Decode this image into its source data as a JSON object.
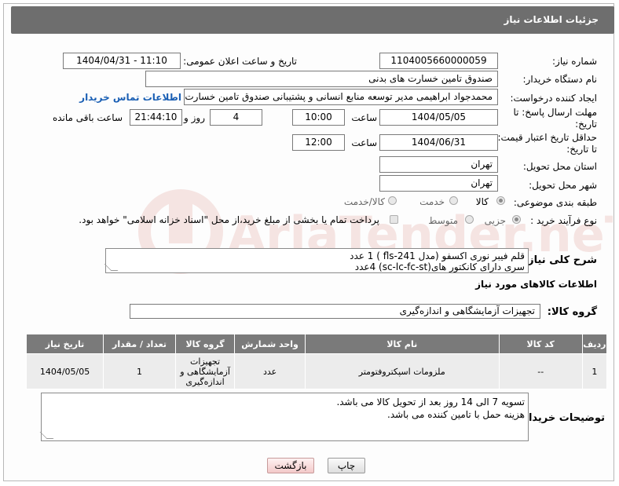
{
  "header": {
    "title": "جزئیات اطلاعات نیاز"
  },
  "fields": {
    "need_number_label": "شماره نیاز:",
    "need_number": "1104005660000059",
    "announce_label": "تاریخ و ساعت اعلان عمومی:",
    "announce_value": "1404/04/31 - 11:10",
    "buyer_org_label": "نام دستگاه خریدار:",
    "buyer_org": "صندوق تامین خسارت های بدنی",
    "creator_label": "ایجاد کننده درخواست:",
    "creator": "محمدجواد ابراهیمی مدیر توسعه منابع انسانی و پشتیبانی صندوق تامین خسارت های بدنی",
    "contact_link": "اطلاعات تماس خریدار",
    "deadline_label_1": "مهلت ارسال پاسخ: تا",
    "deadline_label_2": "تاریخ:",
    "deadline_date": "1404/05/05",
    "time_label": "ساعت",
    "deadline_time": "10:00",
    "days_value": "4",
    "days_label": "روز و",
    "remaining_time": "21:44:10",
    "remaining_label": "ساعت باقی مانده",
    "min_price_label_1": "حداقل تاریخ اعتبار قیمت:",
    "min_price_label_2": "تا تاریخ:",
    "price_date": "1404/06/31",
    "price_time_label": "ساعت",
    "price_time": "12:00",
    "province_label": "استان محل تحویل:",
    "province": "تهران",
    "city_label": "شهر محل تحویل:",
    "city": "تهران",
    "category_label": "طبقه بندی موضوعی:",
    "category_goods": "کالا",
    "category_service": "خدمت",
    "category_both": "کالا/خدمت",
    "process_label": "نوع فرآیند خرید :",
    "process_small": "جزیی",
    "process_medium": "متوسط",
    "process_note": "پرداخت تمام یا بخشی از مبلغ خرید،از محل \"اسناد خزانه اسلامی\" خواهد بود."
  },
  "description": {
    "label": "شرح کلی نیاز:",
    "line1": "قلم فیبر نوری اکسفو (مدل fls-241 ) 1 عدد",
    "line2": "سری دارای کانکتور های(sc-lc-fc-st) 4عدد"
  },
  "goods_info": {
    "title": "اطلاعات کالاهای مورد نیاز",
    "group_label": "گروه کالا:",
    "group_value": "تجهیزات آزمایشگاهی و اندازه‌گیری"
  },
  "table": {
    "headers": [
      "ردیف",
      "کد کالا",
      "نام کالا",
      "واحد شمارش",
      "گروه کالا",
      "تعداد / مقدار",
      "تاریخ نیاز"
    ],
    "rows": [
      [
        "1",
        "--",
        "ملزومات اسپکتروفتومتر",
        "عدد",
        "تجهیزات آزمایشگاهی و اندازه‌گیری",
        "1",
        "1404/05/05"
      ]
    ]
  },
  "buyer_notes": {
    "label": "توضیحات خریدار:",
    "line1": "تسویه 7 الی 14 روز بعد از تحویل کالا می باشد.",
    "line2": "هزینه حمل با تامین کننده می باشد."
  },
  "buttons": {
    "print": "چاپ",
    "back": "بازگشت"
  },
  "watermark": {
    "text": "AriaTender.neT"
  },
  "colors": {
    "header_bg": "#6e6e6e",
    "table_header_bg": "#7a7a7a",
    "link": "#1a5fb4"
  }
}
